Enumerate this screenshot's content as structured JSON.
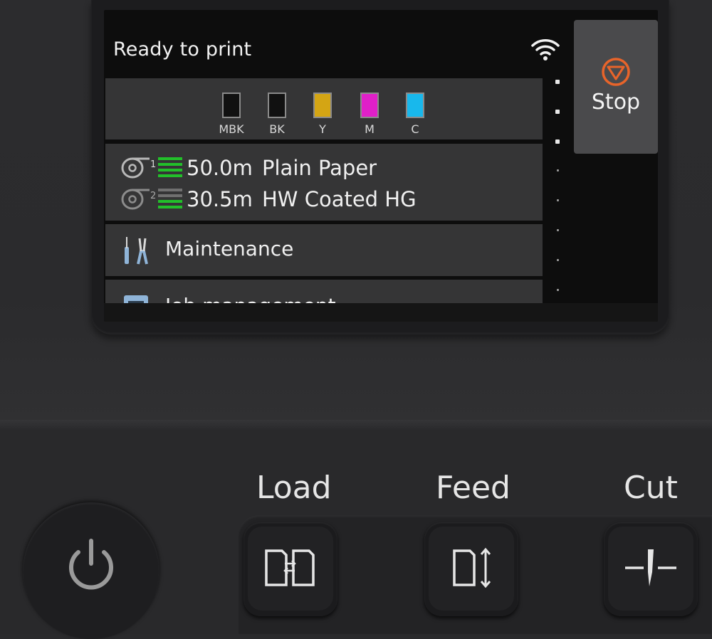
{
  "screen": {
    "status_title": "Ready to print",
    "stop_label": "Stop",
    "inks": [
      {
        "label": "MBK",
        "color": "#111111"
      },
      {
        "label": "BK",
        "color": "#111111"
      },
      {
        "label": "Y",
        "color": "#d4a514"
      },
      {
        "label": "M",
        "color": "#e020c8"
      },
      {
        "label": "C",
        "color": "#18b8ec"
      }
    ],
    "rolls": [
      {
        "number": "1",
        "length": "50.0m",
        "media": "Plain Paper",
        "level": 1.0
      },
      {
        "number": "2",
        "length": "30.5m",
        "media": "HW Coated HG",
        "level": 0.5
      }
    ],
    "menu": {
      "maintenance": "Maintenance",
      "job_management": "Job management"
    }
  },
  "keys": {
    "load_label": "Load",
    "feed_label": "Feed",
    "cut_label": "Cut"
  },
  "colors": {
    "stop_accent": "#e8642a",
    "level_green": "#22c02a",
    "level_grey": "#707070"
  }
}
